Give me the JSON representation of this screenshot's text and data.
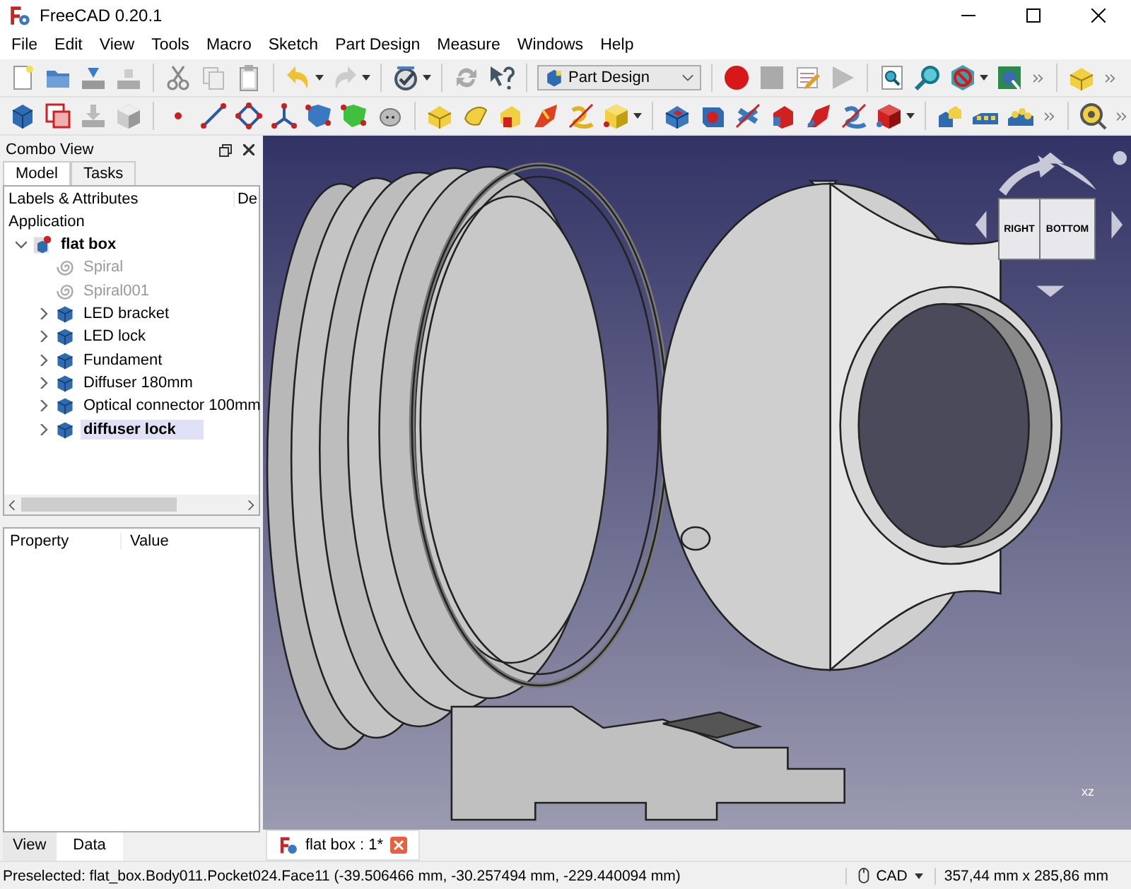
{
  "window": {
    "title": "FreeCAD 0.20.1"
  },
  "menu": [
    "File",
    "Edit",
    "View",
    "Tools",
    "Macro",
    "Sketch",
    "Part Design",
    "Measure",
    "Windows",
    "Help"
  ],
  "toolbar": {
    "workbench": "Part Design"
  },
  "combo_view": {
    "title": "Combo View",
    "tabs": [
      {
        "label": "Model",
        "selected": true
      },
      {
        "label": "Tasks",
        "selected": false
      }
    ],
    "tree": {
      "columns": [
        "Labels & Attributes",
        "De"
      ],
      "root": "Application",
      "items": [
        {
          "label": "flat box",
          "kind": "document",
          "expanded": true,
          "active": true,
          "disabled": false,
          "selected": false,
          "children": [
            {
              "label": "Spiral",
              "kind": "helix",
              "active": false,
              "disabled": true,
              "selected": false
            },
            {
              "label": "Spiral001",
              "kind": "helix",
              "active": false,
              "disabled": true,
              "selected": false
            },
            {
              "label": "LED bracket",
              "kind": "body",
              "expanded": false,
              "active": false,
              "disabled": false,
              "selected": false
            },
            {
              "label": "LED lock",
              "kind": "body",
              "expanded": false,
              "active": false,
              "disabled": false,
              "selected": false
            },
            {
              "label": "Fundament",
              "kind": "body",
              "expanded": false,
              "active": false,
              "disabled": false,
              "selected": false
            },
            {
              "label": "Diffuser 180mm",
              "kind": "body",
              "expanded": false,
              "active": false,
              "disabled": false,
              "selected": false
            },
            {
              "label": "Optical connector 100mm",
              "kind": "body",
              "expanded": false,
              "active": false,
              "disabled": false,
              "selected": false
            },
            {
              "label": "diffuser lock",
              "kind": "body",
              "expanded": false,
              "active": true,
              "disabled": false,
              "selected": true
            }
          ]
        }
      ]
    }
  },
  "property_view": {
    "columns": [
      "Property",
      "Value"
    ],
    "tabs": [
      {
        "label": "View",
        "selected": false
      },
      {
        "label": "Data",
        "selected": true
      }
    ]
  },
  "viewport": {
    "nav_cube": {
      "faces": [
        "RIGHT",
        "BOTTOM"
      ]
    },
    "axes": [
      "x",
      "z"
    ]
  },
  "document_tabs": [
    {
      "label": "flat box : 1*",
      "selected": true
    }
  ],
  "status_bar": {
    "message": "Preselected: flat_box.Body011.Pocket024.Face11 (-39.506466 mm, -30.257494 mm, -229.440094 mm)",
    "navigation": "CAD",
    "dimensions": "357,44 mm x 285,86 mm"
  }
}
